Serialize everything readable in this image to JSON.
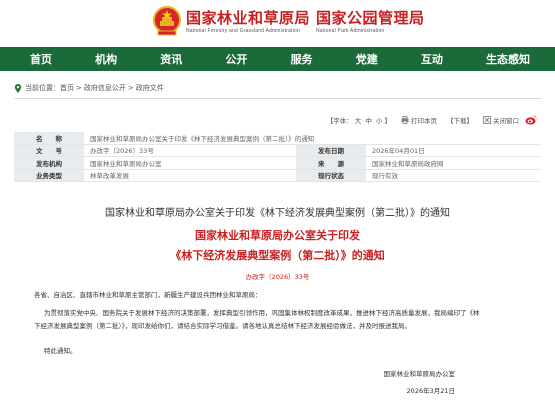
{
  "header": {
    "org1_cn": "国家林业和草原局",
    "org1_en": "National Forestry and Grassland Administration",
    "org2_cn": "国家公园管理局",
    "org2_en": "National Park Administration",
    "emblem_icon": "national-emblem-icon"
  },
  "nav": {
    "items": [
      "首页",
      "机构",
      "资讯",
      "公开",
      "服务",
      "党建",
      "互动",
      "生态感知"
    ],
    "background": "#1a6a3a"
  },
  "breadcrumb": {
    "prefix": "当前位置：",
    "items": [
      "首页",
      "政府信息公开",
      "政府文件"
    ],
    "separator": ">"
  },
  "toolbar": {
    "font_size_label": "【字体：",
    "font_big": "大",
    "font_mid": "中",
    "font_small": "小",
    "font_size_close": "】",
    "print": "打印本页",
    "download": "【下载】",
    "close_window": "关闭窗口"
  },
  "meta": {
    "name_label": "名　　称",
    "name_value": "国家林业和草原局办公室关于印发《林下经济发展典型案例（第二批）》的通知",
    "docno_label": "文　　号",
    "docno_value": "办改字〔2026〕33号",
    "date_label": "发布日期",
    "date_value": "2026年04月01日",
    "issuer_label": "发布机构",
    "issuer_value": "国家林业和草原局办公室",
    "source_label": "来　　源",
    "source_value": "国家林业和草原局政府网",
    "category_label": "业务类型",
    "category_value": "林草改革发展",
    "status_label": "现行状态",
    "status_value": "现行有效"
  },
  "document": {
    "title": "国家林业和草原局办公室关于印发《林下经济发展典型案例（第二批）》的通知",
    "red_line1": "国家林业和草原局办公室关于印发",
    "red_line2": "《林下经济发展典型案例（第二批）》的通知",
    "number": "办改字〔2026〕33号",
    "recipients": "各省、自治区、直辖市林业和草原主管部门，新疆生产建设兵团林业和草原局：",
    "body_line1": "为贯彻落实党中央、国务院关于发展林下经济的决策部署，发挥典型引领作用，巩固集体林权制度改革成果，推进林下经济高质量发展，我局编印了《林",
    "body_line2": "下经济发展典型案例（第二批）》，现印发给你们，请结合实际学习借鉴。请各地认真总结林下经济发展经验做法，并及时报送我局。",
    "closing": "特此通知。",
    "signature": "国家林业和草原局办公室",
    "sign_date": "2026年3月21日"
  }
}
